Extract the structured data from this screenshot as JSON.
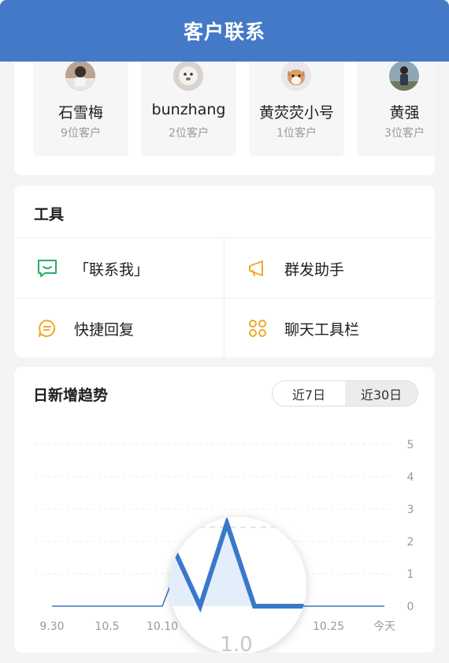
{
  "header": {
    "title": "客户联系"
  },
  "contacts": [
    {
      "name": "石雪梅",
      "count": "9位客户"
    },
    {
      "name": "bunzhang",
      "count": "2位客户"
    },
    {
      "name": "黄荧荧小号",
      "count": "1位客户"
    },
    {
      "name": "黄强",
      "count": "3位客户"
    }
  ],
  "tools": {
    "title": "工具",
    "items": [
      {
        "label": "「联系我」",
        "icon": "chat-bubble-smile-icon"
      },
      {
        "label": "群发助手",
        "icon": "megaphone-icon"
      },
      {
        "label": "快捷回复",
        "icon": "quick-reply-icon"
      },
      {
        "label": "聊天工具栏",
        "icon": "toolbar-grid-icon"
      }
    ]
  },
  "trend": {
    "title": "日新增趋势",
    "range_options": [
      "近7日",
      "近30日"
    ],
    "selected_range": "近30日"
  },
  "colors": {
    "header": "#4479c8",
    "line": "#3a78c9",
    "tool_green": "#2aae67",
    "tool_orange": "#f0a82c"
  },
  "chart_data": {
    "type": "line",
    "x_ticks": [
      "9.30",
      "10.5",
      "10.10",
      "10.25",
      "今天"
    ],
    "y_ticks": [
      0,
      1,
      2,
      3,
      4,
      5
    ],
    "ylim": [
      0,
      5
    ],
    "series": [
      {
        "x": [
          "9.30",
          "10.5",
          "10.10",
          "10.13",
          "10.15",
          "10.17",
          "10.19",
          "10.25",
          "今天"
        ],
        "values": [
          0,
          0,
          0,
          2,
          0,
          2.5,
          0,
          0,
          0
        ]
      }
    ],
    "magnifier_partial_label": "1.0"
  }
}
